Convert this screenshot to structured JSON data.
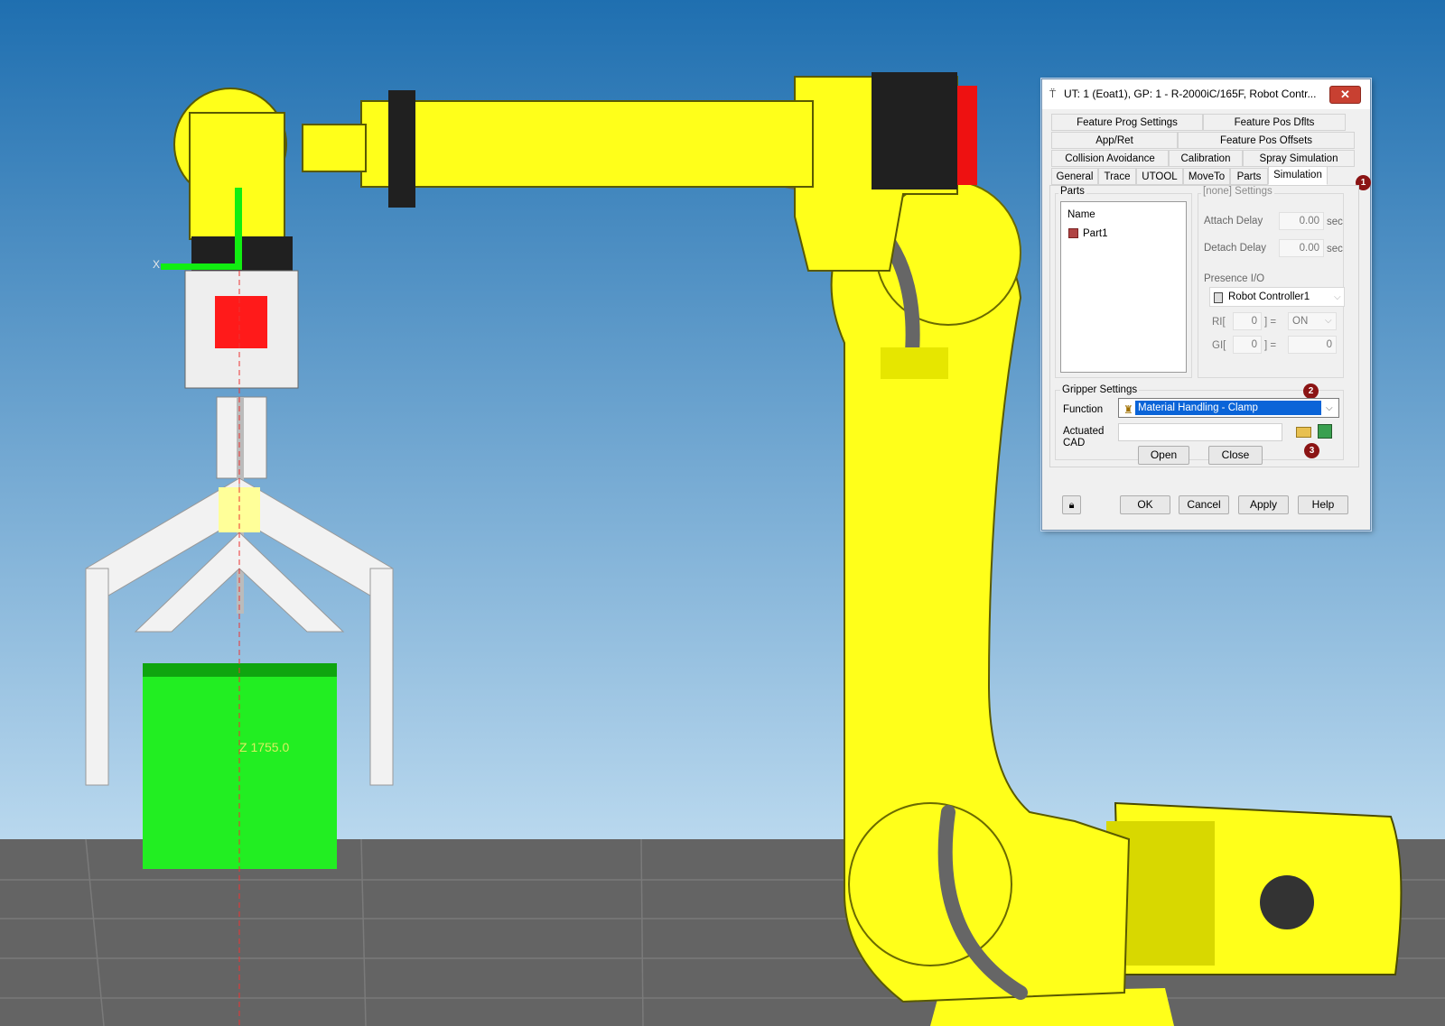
{
  "viewport": {
    "tool_axis_label": "X",
    "z_readout": "Z 1755.0"
  },
  "dialog": {
    "title": "UT: 1  (Eoat1), GP: 1 - R-2000iC/165F, Robot Contr...",
    "close_label": "✕",
    "tabs_row1": [
      "Feature Prog Settings",
      "Feature Pos Dflts"
    ],
    "tabs_row2": [
      "App/Ret",
      "Feature Pos Offsets"
    ],
    "tabs_row3": [
      "Collision Avoidance",
      "Calibration",
      "Spray Simulation"
    ],
    "tabs_row4": [
      "General",
      "Trace",
      "UTOOL",
      "MoveTo",
      "Parts",
      "Simulation"
    ],
    "active_tab": "Simulation",
    "parts": {
      "group_label": "Parts",
      "list_header": "Name",
      "items": [
        "Part1"
      ]
    },
    "settings": {
      "group_label": "[none] Settings",
      "attach_delay_label": "Attach Delay",
      "attach_delay_value": "0.00",
      "attach_delay_unit": "sec",
      "detach_delay_label": "Detach Delay",
      "detach_delay_value": "0.00",
      "detach_delay_unit": "sec",
      "presence_io_label": "Presence I/O",
      "controller": "Robot Controller1",
      "ri_label": "RI[",
      "ri_index": "0",
      "ri_eq": "] =",
      "ri_value": "ON",
      "gi_label": "GI[",
      "gi_index": "0",
      "gi_eq": "] =",
      "gi_value": "0"
    },
    "gripper": {
      "group_label": "Gripper Settings",
      "function_label": "Function",
      "function_value": "Material Handling - Clamp",
      "actuated_label_1": "Actuated",
      "actuated_label_2": "CAD",
      "actuated_value": "",
      "open_label": "Open",
      "close_label": "Close"
    },
    "footer": {
      "ok_label": "OK",
      "cancel_label": "Cancel",
      "apply_label": "Apply",
      "help_label": "Help"
    },
    "badges": [
      "1",
      "2",
      "3"
    ]
  },
  "colors": {
    "robot_yellow": "#ffff1a",
    "part_green": "#22ee22",
    "gripper_red": "#ff1a1a",
    "sky_top": "#1f6fb0",
    "sky_bottom": "#b7d7ee",
    "floor": "#666666",
    "badge": "#8b1414"
  },
  "icons": [
    "robot-tool-icon",
    "close-icon",
    "part-icon",
    "controller-icon",
    "gripper-icon",
    "folder-icon",
    "cad-import-icon",
    "lock-icon",
    "chevron-down-icon"
  ]
}
